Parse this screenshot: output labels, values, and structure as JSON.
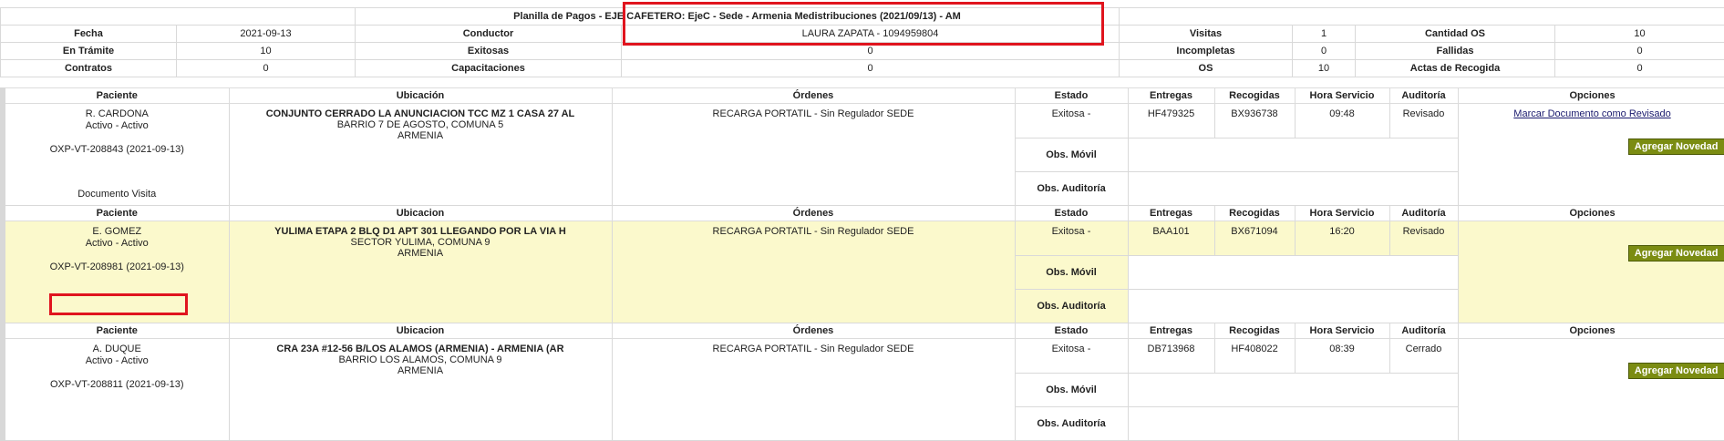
{
  "header": {
    "title": "Planilla de Pagos - EJE CAFETERO: EjeC - Sede - Armenia Medistribuciones (2021/09/13) - AM",
    "rows": [
      [
        {
          "l": "Fecha",
          "v": "2021-09-13"
        },
        {
          "l": "Conductor",
          "v": "LAURA ZAPATA - 1094959804"
        },
        {
          "l": "Visitas",
          "v": "1"
        },
        {
          "l": "Cantidad OS",
          "v": "10"
        }
      ],
      [
        {
          "l": "En Trámite",
          "v": "10"
        },
        {
          "l": "Exitosas",
          "v": "0"
        },
        {
          "l": "Incompletas",
          "v": "0"
        },
        {
          "l": "Fallidas",
          "v": "0"
        }
      ],
      [
        {
          "l": "Contratos",
          "v": "0"
        },
        {
          "l": "Capacitaciones",
          "v": "0"
        },
        {
          "l": "OS",
          "v": "10"
        },
        {
          "l": "Actas de Recogida",
          "v": "0"
        }
      ]
    ]
  },
  "columns": {
    "first": [
      "Paciente",
      "Ubicación",
      "Órdenes",
      "Estado",
      "Entregas",
      "Recogidas",
      "Hora Servicio",
      "Auditoría",
      "Opciones"
    ],
    "repeat": [
      "Paciente",
      "Ubicacion",
      "Órdenes",
      "Estado",
      "Entregas",
      "Recogidas",
      "Hora Servicio",
      "Auditoría",
      "Opciones"
    ]
  },
  "records": [
    {
      "patient_name": "R. CARDONA",
      "patient_status": "Activo - Activo",
      "oxp": "OXP-VT-208843 (2021-09-13)",
      "doc_label": "Documento Visita",
      "addr1": "CONJUNTO CERRADO LA ANUNCIACION TCC MZ 1 CASA 27 AL",
      "addr2": "BARRIO 7 DE AGOSTO, COMUNA 5",
      "addr3": "ARMENIA",
      "order": "RECARGA PORTATIL - Sin Regulador SEDE",
      "estado": "Exitosa -",
      "entregas": "HF479325",
      "recogidas": "BX936738",
      "hora": "09:48",
      "auditoria": "Revisado",
      "link": "Marcar Documento como Revisado",
      "button": "Agregar Novedad",
      "obs_movil": "Obs. Móvil",
      "obs_auditoria": "Obs. Auditoría"
    },
    {
      "patient_name": "E. GOMEZ",
      "patient_status": "Activo - Activo",
      "oxp": "OXP-VT-208981 (2021-09-13)",
      "doc_label": "",
      "addr1": "YULIMA ETAPA 2 BLQ D1 APT 301 LLEGANDO POR LA VIA H",
      "addr2": "SECTOR YULIMA, COMUNA 9",
      "addr3": "ARMENIA",
      "order": "RECARGA PORTATIL - Sin Regulador SEDE",
      "estado": "Exitosa -",
      "entregas": "BAA101",
      "recogidas": "BX671094",
      "hora": "16:20",
      "auditoria": "Revisado",
      "link": "",
      "button": "Agregar Novedad",
      "obs_movil": "Obs. Móvil",
      "obs_auditoria": "Obs. Auditoría"
    },
    {
      "patient_name": "A. DUQUE",
      "patient_status": "Activo - Activo",
      "oxp": "OXP-VT-208811 (2021-09-13)",
      "doc_label": "",
      "addr1": "CRA 23A #12-56 B/LOS ALAMOS (ARMENIA) - ARMENIA (AR",
      "addr2": "BARRIO LOS ALAMOS, COMUNA 9",
      "addr3": "ARMENIA",
      "order": "RECARGA PORTATIL - Sin Regulador SEDE",
      "estado": "Exitosa -",
      "entregas": "DB713968",
      "recogidas": "HF408022",
      "hora": "08:39",
      "auditoria": "Cerrado",
      "link": "",
      "button": "Agregar Novedad",
      "obs_movil": "Obs. Móvil",
      "obs_auditoria": "Obs. Auditoría"
    }
  ]
}
